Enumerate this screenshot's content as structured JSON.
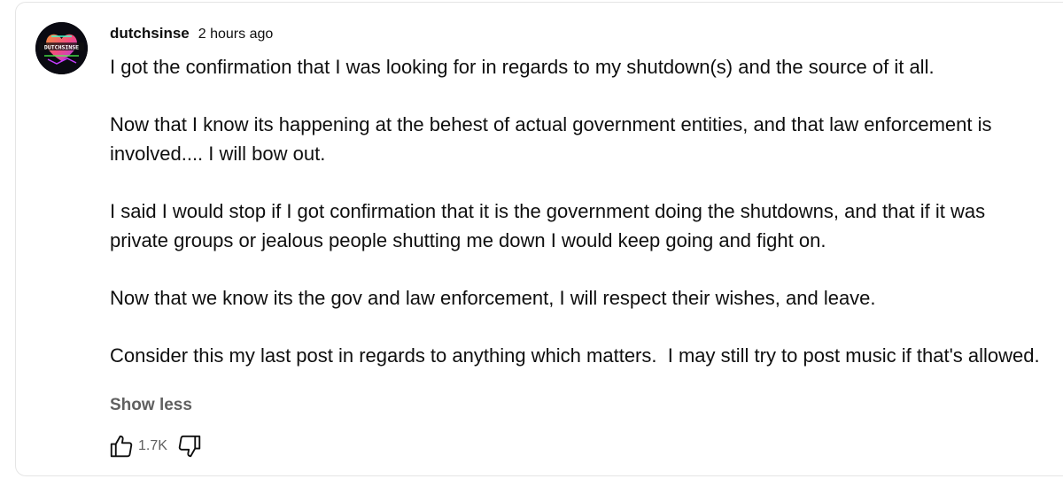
{
  "comment": {
    "author": "dutchsinse",
    "timestamp": "2 hours ago",
    "avatar_text": "DUTCHSINSE",
    "paragraphs": [
      "I got the confirmation that I was looking for in regards to my shutdown(s) and the source of it all.",
      "Now that I know its happening at the behest of actual government entities, and that law enforcement is involved.... I will bow out.",
      "I said I would stop if I got confirmation that it is the government doing the shutdowns, and that if it was private groups or jealous people shutting me down I would keep going and fight on.",
      "Now that we know its the gov and law enforcement, I will respect their wishes, and leave.",
      "Consider this my last post in regards to anything which matters.  I may still try to post music if that's allowed."
    ],
    "show_less_label": "Show less",
    "like_count": "1.7K",
    "like_icon": "thumbs-up-icon",
    "dislike_icon": "thumbs-down-icon"
  },
  "colors": {
    "text": "#0f0f0f",
    "secondary_text": "#606060",
    "border": "#e5e5e5",
    "background": "#ffffff"
  }
}
